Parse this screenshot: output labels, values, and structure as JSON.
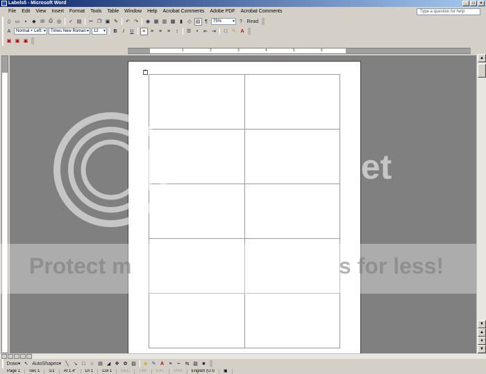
{
  "window": {
    "title": "Labels5 - Microsoft Word",
    "controls": [
      "_",
      "□",
      "×"
    ]
  },
  "menubar": {
    "items": [
      "File",
      "Edit",
      "View",
      "Insert",
      "Format",
      "Tools",
      "Table",
      "Window",
      "Help",
      "Acrobat Comments",
      "Adobe PDF",
      "Acrobat Comments"
    ],
    "help_placeholder": "Type a question for help"
  },
  "standard_toolbar": {
    "zoom": "75%",
    "read_label": "Read"
  },
  "formatting_toolbar": {
    "style": "Normal + Left:",
    "font": "Times New Roman",
    "size": "12",
    "bold": "B",
    "italic": "I",
    "underline": "U"
  },
  "ruler": {
    "numbers": [
      "1",
      "2",
      "3",
      "4",
      "5",
      "6"
    ]
  },
  "document": {
    "label_rows": 5,
    "label_cols": 2
  },
  "watermark": {
    "line1": "ket",
    "line2": "Protect m",
    "line3": "s for less!"
  },
  "drawing_toolbar": {
    "draw_label": "Draw",
    "autoshapes_label": "AutoShapes"
  },
  "statusbar": {
    "items": [
      "Page 1",
      "Sec 1",
      "1/1",
      "At 1.4\"",
      "Ln 1",
      "Col 1"
    ],
    "modes": [
      "REC",
      "TRK",
      "EXT",
      "OVR"
    ],
    "language": "English (U.S"
  },
  "icons": [
    "new-doc-icon",
    "open-icon",
    "save-icon",
    "print-icon",
    "spelling-icon",
    "cut-icon",
    "copy-icon",
    "paste-icon",
    "undo-icon",
    "redo-icon",
    "table-icon",
    "help-icon"
  ]
}
